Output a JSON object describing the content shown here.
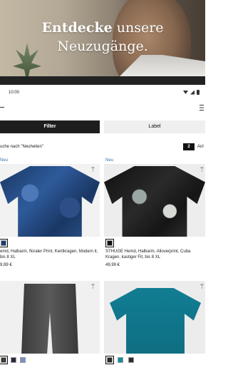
{
  "hero": {
    "headline_bold": "Entdecke",
    "headline_rest": " unsere",
    "headline_line2": "Neuzugänge."
  },
  "status": {
    "time": "10:00"
  },
  "filters": {
    "filter_label": "Filter",
    "label_label": "Label"
  },
  "search": {
    "info": "uche nach \"Neuheiten\"",
    "count_value": "2",
    "count_label": "Anl"
  },
  "colors": {
    "badge": "#3b6fb0",
    "dark": "#1e1e1e"
  },
  "products": [
    {
      "badge": "Neu",
      "title": "emd, Halbarm, floraler Print, Kentkragen, Modern it, bis 8 XL",
      "price": "9,99 €",
      "swatches": [
        "#1b3c6e"
      ]
    },
    {
      "badge": "Neu",
      "title": "STHUGE Hemd, Halbarm, Alloverprint, Cuba Kragen, kastiger Fit, bis 8 XL",
      "price": "49,99 €",
      "swatches": [
        "#111111"
      ]
    },
    {
      "badge": "",
      "title": "",
      "price": "",
      "swatches": [
        "#3a3a3a",
        "#2b2b3a",
        "#7a8fc4"
      ]
    },
    {
      "badge": "",
      "title": "",
      "price": "",
      "swatches": [
        "#2a2a2a",
        "#0f8c9e",
        "#2c2c2c"
      ]
    }
  ]
}
